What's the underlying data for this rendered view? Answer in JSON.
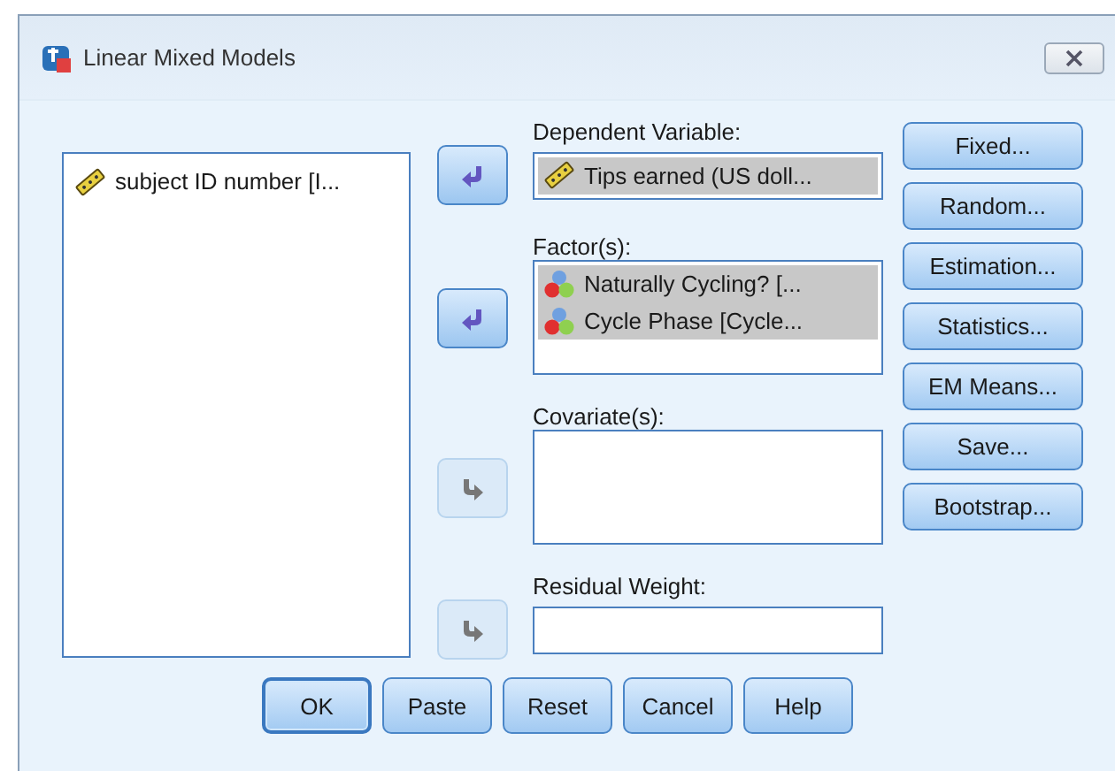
{
  "window": {
    "title": "Linear Mixed Models"
  },
  "variable_list": {
    "items": [
      {
        "label": "subject ID number [I...",
        "kind": "scale",
        "selected": false
      }
    ]
  },
  "targets": [
    {
      "label": "Dependent Variable:",
      "kind": "single",
      "arrow": {
        "disabled": false
      },
      "items": [
        {
          "label": "Tips earned (US doll...",
          "kind": "scale",
          "selected": true
        }
      ]
    },
    {
      "label": "Factor(s):",
      "kind": "list",
      "arrow": {
        "disabled": false
      },
      "items": [
        {
          "label": "Naturally Cycling? [...",
          "kind": "nominal",
          "selected": true
        },
        {
          "label": "Cycle Phase [Cycle...",
          "kind": "nominal",
          "selected": true
        }
      ]
    },
    {
      "label": "Covariate(s):",
      "kind": "list",
      "arrow": {
        "disabled": true
      }
    },
    {
      "label": "Residual Weight:",
      "kind": "single",
      "arrow": {
        "disabled": true
      }
    }
  ],
  "side_buttons": [
    "Fixed...",
    "Random...",
    "Estimation...",
    "Statistics...",
    "EM Means...",
    "Save...",
    "Bootstrap..."
  ],
  "buttons": [
    {
      "label": "OK",
      "default": true
    },
    {
      "label": "Paste",
      "default": false
    },
    {
      "label": "Reset",
      "default": false
    },
    {
      "label": "Cancel",
      "default": false
    },
    {
      "label": "Help",
      "default": false
    }
  ]
}
